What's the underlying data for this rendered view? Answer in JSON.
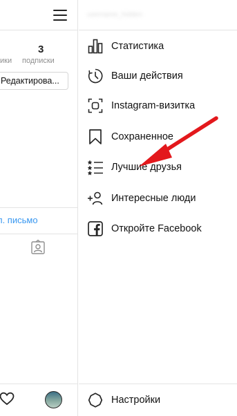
{
  "left_panel": {
    "following_count": "3",
    "stat_label_partial": "ики",
    "following_label": "подписки",
    "edit_button_label": "Редактирова...",
    "email_link": "л. письмо"
  },
  "drawer": {
    "username": "username_hidden",
    "items": [
      {
        "label": "Статистика",
        "icon": "bar-chart-icon"
      },
      {
        "label": "Ваши действия",
        "icon": "activity-clock-icon"
      },
      {
        "label": "Instagram-визитка",
        "icon": "nametag-scan-icon"
      },
      {
        "label": "Сохраненное",
        "icon": "bookmark-icon"
      },
      {
        "label": "Лучшие друзья",
        "icon": "close-friends-list-icon"
      },
      {
        "label": "Интересные люди",
        "icon": "discover-people-icon"
      },
      {
        "label": "Откройте Facebook",
        "icon": "facebook-icon"
      }
    ],
    "settings_label": "Настройки"
  },
  "colors": {
    "link": "#3897f0",
    "annotation_arrow": "#e3181c",
    "divider": "#e3e3e3"
  }
}
